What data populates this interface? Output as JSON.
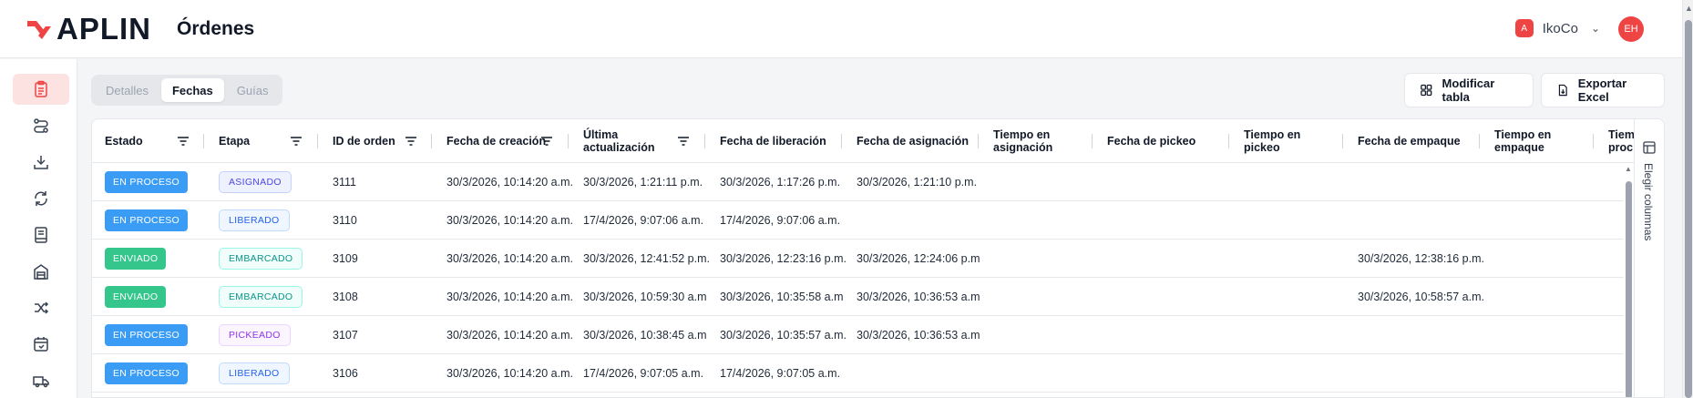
{
  "header": {
    "logo_text": "APLIN",
    "page_title": "Órdenes",
    "org_initial": "A",
    "org_name": "IkoCo",
    "avatar_initials": "EH"
  },
  "tabs": [
    {
      "label": "Detalles",
      "active": false
    },
    {
      "label": "Fechas",
      "active": true
    },
    {
      "label": "Guías",
      "active": false
    }
  ],
  "actions": {
    "modify_table": "Modificar tabla",
    "export_excel": "Exportar Excel"
  },
  "side_chooser_label": "Elegir columnas",
  "sidebar_icons": [
    "orders-icon",
    "routes-icon",
    "inbound-icon",
    "returns-icon",
    "catalog-icon",
    "warehouse-icon",
    "transfers-icon",
    "calendar-icon",
    "shipping-icon"
  ],
  "columns": {
    "estado": "Estado",
    "etapa": "Etapa",
    "id": "ID de orden",
    "creacion": "Fecha de creación",
    "actualizacion_1": "Última",
    "actualizacion_2": "actualización",
    "liberacion": "Fecha de liberación",
    "asignacion": "Fecha de asignación",
    "t_asignacion_1": "Tiempo en",
    "t_asignacion_2": "asignación",
    "pickeo": "Fecha de pickeo",
    "t_pickeo_1": "Tiempo en",
    "t_pickeo_2": "pickeo",
    "empaque": "Fecha de empaque",
    "t_empaque_1": "Tiempo en",
    "t_empaque_2": "empaque",
    "t_proc_1": "Tiem",
    "t_proc_2": "proc"
  },
  "rows": [
    {
      "estado": "EN PROCESO",
      "etapa": "ASIGNADO",
      "id": "3111",
      "creacion": "30/3/2026, 10:14:20 a.m.",
      "actualizacion": "30/3/2026, 1:21:11 p.m.",
      "liberacion": "30/3/2026, 1:17:26 p.m.",
      "asignacion": "30/3/2026, 1:21:10 p.m.",
      "empaque": ""
    },
    {
      "estado": "EN PROCESO",
      "etapa": "LIBERADO",
      "id": "3110",
      "creacion": "30/3/2026, 10:14:20 a.m.",
      "actualizacion": "17/4/2026, 9:07:06 a.m.",
      "liberacion": "17/4/2026, 9:07:06 a.m.",
      "asignacion": "",
      "empaque": ""
    },
    {
      "estado": "ENVIADO",
      "etapa": "EMBARCADO",
      "id": "3109",
      "creacion": "30/3/2026, 10:14:20 a.m.",
      "actualizacion": "30/3/2026, 12:41:52 p.m.",
      "liberacion": "30/3/2026, 12:23:16 p.m.",
      "asignacion": "30/3/2026, 12:24:06 p.m",
      "empaque": "30/3/2026, 12:38:16 p.m."
    },
    {
      "estado": "ENVIADO",
      "etapa": "EMBARCADO",
      "id": "3108",
      "creacion": "30/3/2026, 10:14:20 a.m.",
      "actualizacion": "30/3/2026, 10:59:30 a.m",
      "liberacion": "30/3/2026, 10:35:58 a.m",
      "asignacion": "30/3/2026, 10:36:53 a.m",
      "empaque": "30/3/2026, 10:58:57 a.m."
    },
    {
      "estado": "EN PROCESO",
      "etapa": "PICKEADO",
      "id": "3107",
      "creacion": "30/3/2026, 10:14:20 a.m.",
      "actualizacion": "30/3/2026, 10:38:45 a.m",
      "liberacion": "30/3/2026, 10:35:57 a.m.",
      "asignacion": "30/3/2026, 10:36:53 a.m",
      "empaque": ""
    },
    {
      "estado": "EN PROCESO",
      "etapa": "LIBERADO",
      "id": "3106",
      "creacion": "30/3/2026, 10:14:20 a.m.",
      "actualizacion": "17/4/2026, 9:07:05 a.m.",
      "liberacion": "17/4/2026, 9:07:05 a.m.",
      "asignacion": "",
      "empaque": ""
    }
  ],
  "colors": {
    "brand": "#ef4444",
    "estado_en_proceso": "#3b9cf5",
    "estado_enviado": "#34c68a",
    "etapa_asignado": "#4f46e5",
    "etapa_liberado": "#2563eb",
    "etapa_embarcado": "#0d9488",
    "etapa_pickeado": "#9333ea"
  }
}
